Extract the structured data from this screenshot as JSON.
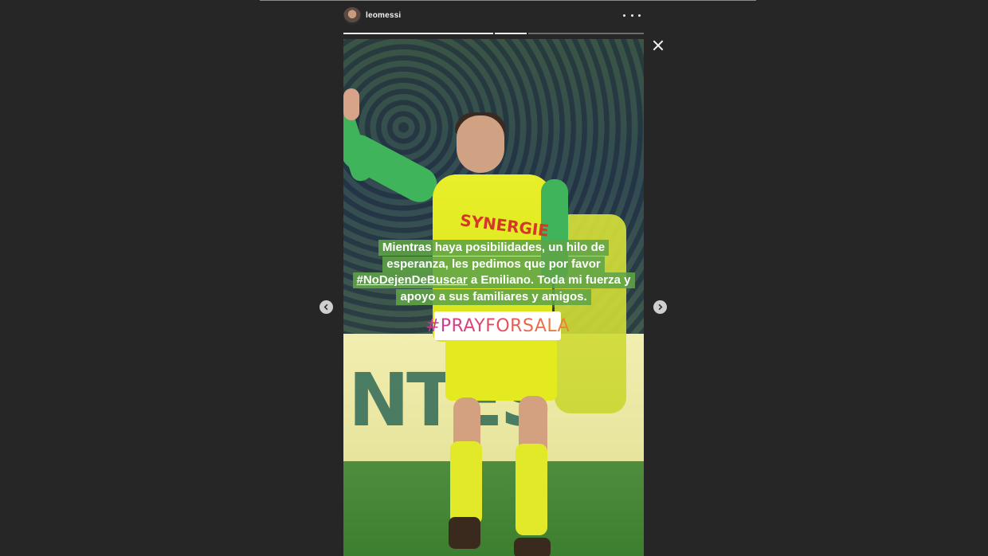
{
  "header": {
    "username": "leomessi",
    "avatar_icon": "avatar",
    "more_icon": "more-options-icon"
  },
  "progress": {
    "segments": [
      {
        "filled": 1.0
      },
      {
        "filled": 1.0
      },
      {
        "filled": 0.0
      }
    ]
  },
  "story": {
    "board_text": "NTES",
    "sponsor_text": "SYNERGIE",
    "caption_lines": [
      "Mientras haya posibilidades, un hilo de",
      "esperanza, les pedimos que por favor",
      "a Emiliano. Toda mi fuerza y",
      "apoyo a sus familiares y amigos."
    ],
    "caption_hashtag": "#NoDejenDeBuscar",
    "hashtag_sticker": "#PRAYFORSALA"
  },
  "controls": {
    "close_icon": "close-icon",
    "prev_icon": "chevron-left-icon",
    "next_icon": "chevron-right-icon"
  },
  "colors": {
    "background": "#262626",
    "caption_bg": "#5ea446",
    "sticker_gradient_start": "#c8369e",
    "sticker_gradient_end": "#e88a3a"
  }
}
